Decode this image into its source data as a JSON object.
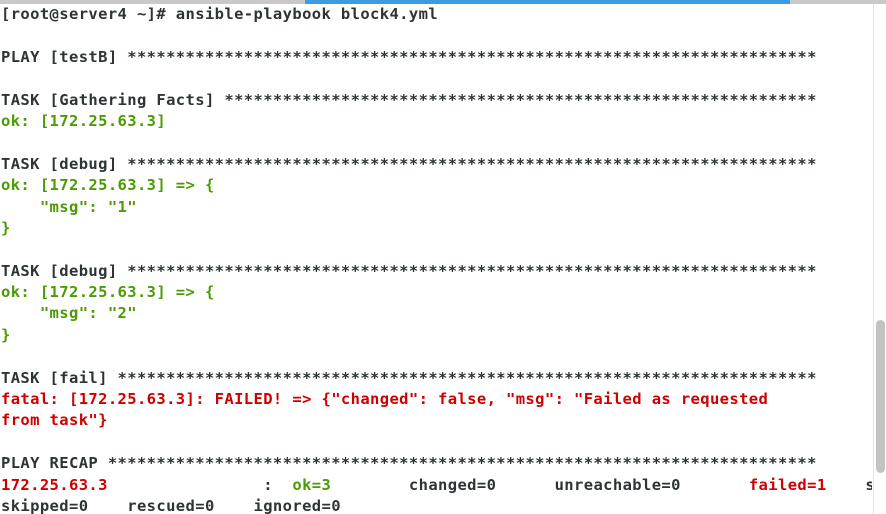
{
  "window": {
    "title": "root@server4:~ terminal",
    "top_bar_color": "#c9c9c9",
    "progress_color": "#3d9be0"
  },
  "palette": {
    "default": "#2e3436",
    "green": "#4e9a06",
    "red": "#cc0000",
    "background": "#ffffff"
  },
  "scrollbar": {
    "thumb_color": "#c2c2c2",
    "track_color": "#ffffff",
    "thumb_top_pct": 62,
    "thumb_height_pct": 30
  },
  "terminal": {
    "prompt": "[root@server4 ~]# ",
    "command": "ansible-playbook block4.yml",
    "lines": [
      {
        "id": "line-prompt",
        "color": "default",
        "text": "[root@server4 ~]# ansible-playbook block4.yml"
      },
      {
        "id": "line-blank-1",
        "color": "default",
        "text": ""
      },
      {
        "id": "line-play-testb",
        "color": "default",
        "text": "PLAY [testB] ***********************************************************************"
      },
      {
        "id": "line-blank-2",
        "color": "default",
        "text": ""
      },
      {
        "id": "line-task-gather",
        "color": "default",
        "text": "TASK [Gathering Facts] *************************************************************"
      },
      {
        "id": "line-ok-gather",
        "color": "green",
        "text": "ok: [172.25.63.3]"
      },
      {
        "id": "line-blank-3",
        "color": "default",
        "text": ""
      },
      {
        "id": "line-task-debug-1",
        "color": "default",
        "text": "TASK [debug] ***********************************************************************"
      },
      {
        "id": "line-ok-debug-1",
        "color": "green",
        "text": "ok: [172.25.63.3] => {"
      },
      {
        "id": "line-msg-1",
        "color": "green",
        "text": "    \"msg\": \"1\""
      },
      {
        "id": "line-close-1",
        "color": "green",
        "text": "}"
      },
      {
        "id": "line-blank-4",
        "color": "default",
        "text": ""
      },
      {
        "id": "line-task-debug-2",
        "color": "default",
        "text": "TASK [debug] ***********************************************************************"
      },
      {
        "id": "line-ok-debug-2",
        "color": "green",
        "text": "ok: [172.25.63.3] => {"
      },
      {
        "id": "line-msg-2",
        "color": "green",
        "text": "    \"msg\": \"2\""
      },
      {
        "id": "line-close-2",
        "color": "green",
        "text": "}"
      },
      {
        "id": "line-blank-5",
        "color": "default",
        "text": ""
      },
      {
        "id": "line-task-fail",
        "color": "default",
        "text": "TASK [fail] ************************************************************************"
      },
      {
        "id": "line-fatal-1",
        "color": "red",
        "text": "fatal: [172.25.63.3]: FAILED! => {\"changed\": false, \"msg\": \"Failed as requested"
      },
      {
        "id": "line-fatal-2",
        "color": "red",
        "text": "from task\"}"
      },
      {
        "id": "line-blank-6",
        "color": "default",
        "text": ""
      },
      {
        "id": "line-play-recap",
        "color": "default",
        "text": "PLAY RECAP *************************************************************************"
      }
    ],
    "recap": {
      "host": "172.25.63.3",
      "host_color": "red",
      "separator": ":",
      "stats": [
        {
          "label": "ok=3",
          "color": "green"
        },
        {
          "label": "changed=0",
          "color": "default"
        },
        {
          "label": "unreachable=0",
          "color": "default"
        },
        {
          "label": "failed=1",
          "color": "red"
        },
        {
          "label": "s",
          "color": "default"
        }
      ]
    },
    "clipped_last_line": "skipped=0    rescued=0    ignored=0"
  }
}
